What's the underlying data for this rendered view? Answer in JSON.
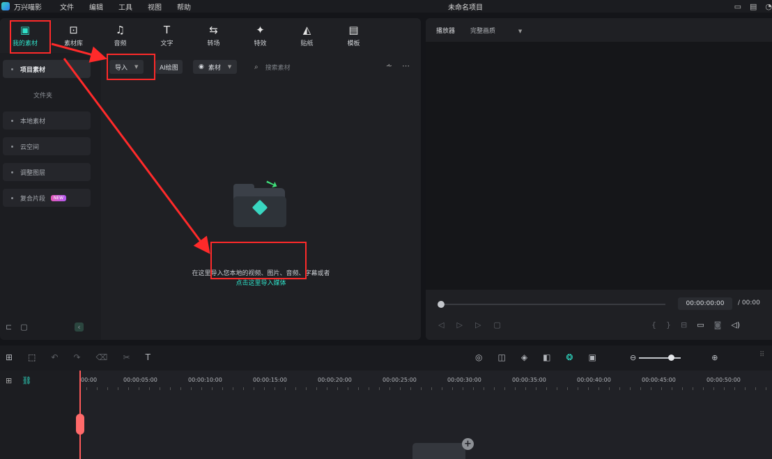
{
  "titlebar": {
    "app_name": "万兴喵影",
    "menu": [
      "文件",
      "编辑",
      "工具",
      "视图",
      "帮助"
    ],
    "project_title": "未命名项目"
  },
  "toolbar": {
    "tools": [
      {
        "label": "我的素材",
        "icon": "my-media-icon"
      },
      {
        "label": "素材库",
        "icon": "library-icon"
      },
      {
        "label": "音频",
        "icon": "music-note-icon"
      },
      {
        "label": "文字",
        "icon": "text-icon"
      },
      {
        "label": "转场",
        "icon": "transition-icon"
      },
      {
        "label": "特效",
        "icon": "effects-icon"
      },
      {
        "label": "贴纸",
        "icon": "sticker-icon"
      },
      {
        "label": "模板",
        "icon": "template-icon"
      }
    ]
  },
  "sidebar": {
    "items": [
      {
        "label": "项目素材"
      },
      {
        "label": "本地素材"
      },
      {
        "label": "云空间"
      },
      {
        "label": "调整图层"
      },
      {
        "label": "复合片段",
        "badge": "NEW"
      }
    ],
    "sub_folder": "文件夹"
  },
  "filterbar": {
    "import_label": "导入",
    "ai_label": "AI绘图",
    "media_label": "素材",
    "search_placeholder": "搜索素材"
  },
  "empty_state": {
    "hint": "在这里导入您本地的视频、图片、音频、字幕或者",
    "link": "点击这里导入媒体"
  },
  "player": {
    "title": "播放器",
    "quality": "完整画质",
    "timecode": "00:00:00:00",
    "total_prefix": "/",
    "total_time": "00:00"
  },
  "timeline": {
    "ruler_labels": [
      "00:00",
      "00:00:05:00",
      "00:00:10:00",
      "00:00:15:00",
      "00:00:20:00",
      "00:00:25:00",
      "00:00:30:00",
      "00:00:35:00",
      "00:00:40:00",
      "00:00:45:00",
      "00:00:50:00"
    ]
  }
}
